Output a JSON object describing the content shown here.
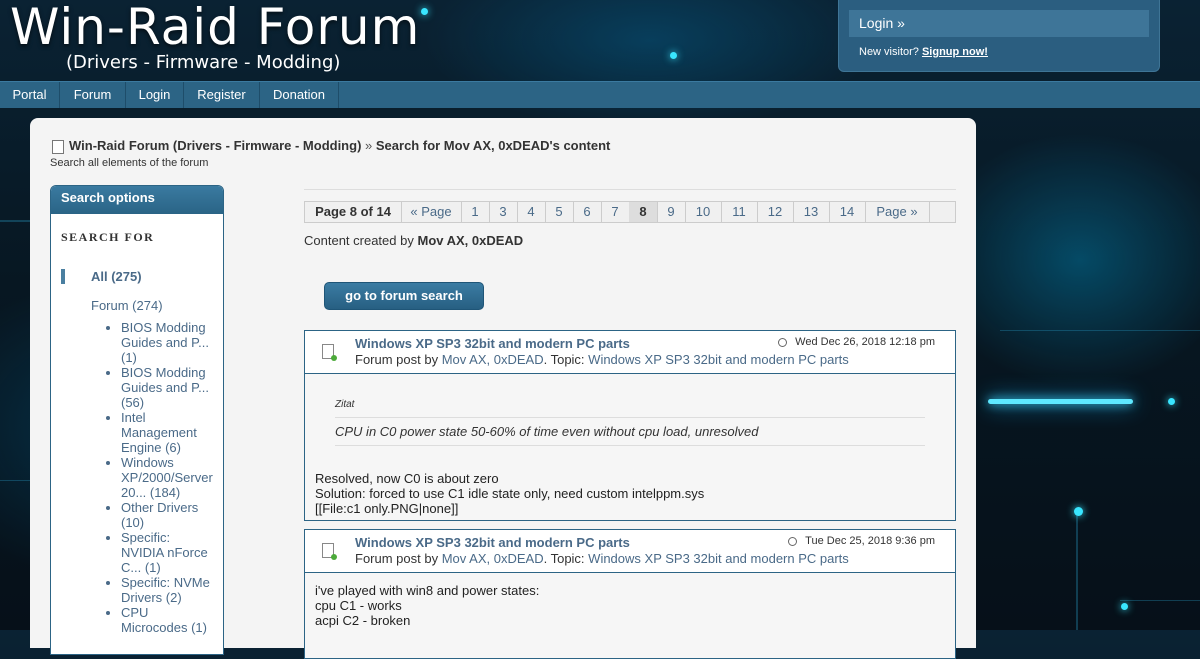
{
  "header": {
    "site_title": "Win-Raid Forum",
    "site_subtitle": "(Drivers - Firmware - Modding)"
  },
  "login_box": {
    "login_label": "Login »",
    "new_visitor_text": "New visitor?",
    "signup_label": "Signup now!"
  },
  "nav": {
    "items": [
      "Portal",
      "Forum",
      "Login",
      "Register",
      "Donation"
    ]
  },
  "breadcrumb": {
    "home": "Win-Raid Forum (Drivers - Firmware - Modding)",
    "separator": "»",
    "current": "Search for Mov AX, 0xDEAD's content",
    "description": "Search all elements of the forum"
  },
  "sidebar": {
    "title": "Search options",
    "search_for_label": "SEARCH FOR",
    "all_label": "All (275)",
    "forum_label": "Forum (274)",
    "items": [
      "BIOS Modding Guides and P... (1)",
      "BIOS Modding Guides and P... (56)",
      "Intel Management Engine (6)",
      "Windows XP/2000/Server 20... (184)",
      "Other Drivers (10)",
      "Specific: NVIDIA nForce C... (1)",
      "Specific: NVMe Drivers (2)",
      "CPU Microcodes (1)"
    ]
  },
  "pagination": {
    "info": "Page 8 of 14",
    "prev_label": "« Page",
    "pages": [
      "1",
      "3",
      "4",
      "5",
      "6",
      "7",
      "8",
      "9",
      "10",
      "11",
      "12",
      "13",
      "14"
    ],
    "current_page": "8",
    "next_label": "Page »"
  },
  "content_by": {
    "prefix": "Content created by",
    "author": "Mov AX, 0xDEAD"
  },
  "go_search_button": "go to forum search",
  "posts": [
    {
      "title": "Windows XP SP3 32bit and modern PC parts",
      "date": "Wed Dec 26, 2018 12:18 pm",
      "by_prefix": "Forum post by",
      "author": "Mov AX, 0xDEAD",
      "topic_prefix": ". Topic:",
      "topic": "Windows XP SP3 32bit and modern PC parts",
      "quote_label": "Zitat",
      "quote": "CPU in C0 power state 50-60% of time even without cpu load, unresolved",
      "lines": [
        "Resolved, now C0 is about zero",
        "Solution: forced to use C1 idle state only, need custom intelppm.sys",
        "[[File:c1 only.PNG|none]]"
      ]
    },
    {
      "title": "Windows XP SP3 32bit and modern PC parts",
      "date": "Tue Dec 25, 2018 9:36 pm",
      "by_prefix": "Forum post by",
      "author": "Mov AX, 0xDEAD",
      "topic_prefix": ". Topic:",
      "topic": "Windows XP SP3 32bit and modern PC parts",
      "lines": [
        "i've played with win8 and power states:",
        "cpu C1 - works",
        "acpi C2 - broken"
      ]
    }
  ]
}
